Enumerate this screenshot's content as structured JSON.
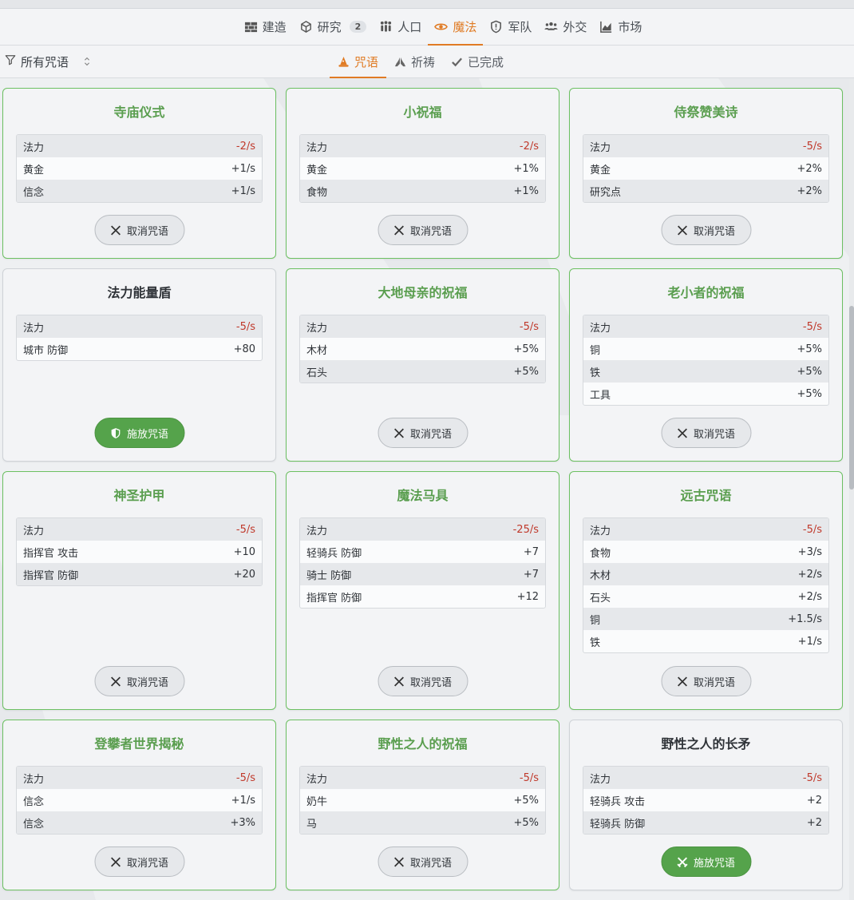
{
  "main_tabs": [
    {
      "label": "建造",
      "icon": "brick-icon",
      "badge": null
    },
    {
      "label": "研究",
      "icon": "flask-icon",
      "badge": "2"
    },
    {
      "label": "人口",
      "icon": "people-icon",
      "badge": null
    },
    {
      "label": "魔法",
      "icon": "eye-icon",
      "badge": null,
      "active": true
    },
    {
      "label": "军队",
      "icon": "shield-icon",
      "badge": null
    },
    {
      "label": "外交",
      "icon": "handshake-icon",
      "badge": null
    },
    {
      "label": "市场",
      "icon": "chart-icon",
      "badge": null
    }
  ],
  "filter": {
    "label": "所有咒语"
  },
  "sub_tabs": [
    {
      "label": "咒语",
      "icon": "wizard-hat-icon",
      "active": true
    },
    {
      "label": "祈祷",
      "icon": "praying-hands-icon"
    },
    {
      "label": "已完成",
      "icon": "check-icon"
    }
  ],
  "buttons": {
    "cancel": "取消咒语",
    "cast": "施放咒语"
  },
  "spells": [
    {
      "title": "寺庙仪式",
      "active": true,
      "stats": [
        [
          "法力",
          "-2/s"
        ],
        [
          "黄金",
          "+1/s"
        ],
        [
          "信念",
          "+1/s"
        ]
      ]
    },
    {
      "title": "小祝福",
      "active": true,
      "stats": [
        [
          "法力",
          "-2/s"
        ],
        [
          "黄金",
          "+1%"
        ],
        [
          "食物",
          "+1%"
        ]
      ]
    },
    {
      "title": "侍祭赞美诗",
      "active": true,
      "stats": [
        [
          "法力",
          "-5/s"
        ],
        [
          "黄金",
          "+2%"
        ],
        [
          "研究点",
          "+2%"
        ]
      ]
    },
    {
      "title": "法力能量盾",
      "active": false,
      "cast_icon": "shield-icon",
      "stats": [
        [
          "法力",
          "-5/s"
        ],
        [
          "城市 防御",
          "+80"
        ]
      ]
    },
    {
      "title": "大地母亲的祝福",
      "active": true,
      "stats": [
        [
          "法力",
          "-5/s"
        ],
        [
          "木材",
          "+5%"
        ],
        [
          "石头",
          "+5%"
        ]
      ]
    },
    {
      "title": "老小者的祝福",
      "active": true,
      "stats": [
        [
          "法力",
          "-5/s"
        ],
        [
          "铜",
          "+5%"
        ],
        [
          "铁",
          "+5%"
        ],
        [
          "工具",
          "+5%"
        ]
      ]
    },
    {
      "title": "神圣护甲",
      "active": true,
      "stats": [
        [
          "法力",
          "-5/s"
        ],
        [
          "指挥官 攻击",
          "+10"
        ],
        [
          "指挥官 防御",
          "+20"
        ]
      ]
    },
    {
      "title": "魔法马具",
      "active": true,
      "stats": [
        [
          "法力",
          "-25/s"
        ],
        [
          "轻骑兵 防御",
          "+7"
        ],
        [
          "骑士 防御",
          "+7"
        ],
        [
          "指挥官 防御",
          "+12"
        ]
      ]
    },
    {
      "title": "远古咒语",
      "active": true,
      "stats": [
        [
          "法力",
          "-5/s"
        ],
        [
          "食物",
          "+3/s"
        ],
        [
          "木材",
          "+2/s"
        ],
        [
          "石头",
          "+2/s"
        ],
        [
          "铜",
          "+1.5/s"
        ],
        [
          "铁",
          "+1/s"
        ]
      ]
    },
    {
      "title": "登攀者世界揭秘",
      "active": true,
      "stats": [
        [
          "法力",
          "-5/s"
        ],
        [
          "信念",
          "+1/s"
        ],
        [
          "信念",
          "+3%"
        ]
      ]
    },
    {
      "title": "野性之人的祝福",
      "active": true,
      "stats": [
        [
          "法力",
          "-5/s"
        ],
        [
          "奶牛",
          "+5%"
        ],
        [
          "马",
          "+5%"
        ]
      ]
    },
    {
      "title": "野性之人的长矛",
      "active": false,
      "cast_icon": "swords-icon",
      "stats": [
        [
          "法力",
          "-5/s"
        ],
        [
          "轻骑兵 攻击",
          "+2"
        ],
        [
          "轻骑兵 防御",
          "+2"
        ]
      ]
    }
  ]
}
